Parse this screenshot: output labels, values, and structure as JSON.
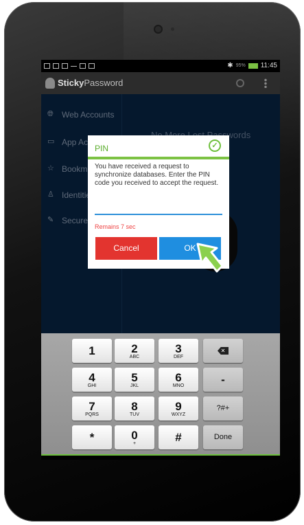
{
  "status_bar": {
    "battery_percent": "95%",
    "time": "11:45",
    "icons": [
      "photo-icon",
      "notification-icon",
      "notification-icon",
      "mail-icon",
      "bag-icon",
      "image-icon"
    ]
  },
  "app_bar": {
    "brand_bold": "Sticky",
    "brand_rest": "Password"
  },
  "sidebar": {
    "items": [
      {
        "label": "Web Accounts",
        "icon": "globe-icon"
      },
      {
        "label": "App Ac",
        "icon": "monitor-icon"
      },
      {
        "label": "Bookm",
        "icon": "star-icon"
      },
      {
        "label": "Identitie",
        "icon": "person-icon"
      },
      {
        "label": "Secure",
        "icon": "note-icon"
      }
    ]
  },
  "main": {
    "headline": "No More Lost Passwords"
  },
  "dialog": {
    "title": "PIN",
    "message": "You have received a request to synchronize databases. Enter the PIN code you received to accept the request.",
    "pin_value": "",
    "remaining": "Remains 7 sec",
    "cancel_label": "Cancel",
    "ok_label": "OK"
  },
  "keyboard": {
    "rows": [
      [
        {
          "n": "1",
          "s": ""
        },
        {
          "n": "2",
          "s": "ABC"
        },
        {
          "n": "3",
          "s": "DEF"
        },
        {
          "n": "⌫",
          "s": "",
          "special": "backspace"
        }
      ],
      [
        {
          "n": "4",
          "s": "GHI"
        },
        {
          "n": "5",
          "s": "JKL"
        },
        {
          "n": "6",
          "s": "MNO"
        },
        {
          "n": "-",
          "s": ""
        }
      ],
      [
        {
          "n": "7",
          "s": "PQRS"
        },
        {
          "n": "8",
          "s": "TUV"
        },
        {
          "n": "9",
          "s": "WXYZ"
        },
        {
          "n": "?#+",
          "s": ""
        }
      ],
      [
        {
          "n": "*",
          "s": ""
        },
        {
          "n": "0",
          "s": "+"
        },
        {
          "n": "#",
          "s": ""
        },
        {
          "n": "Done",
          "s": ""
        }
      ]
    ]
  },
  "colors": {
    "accent_green": "#7cc243",
    "cancel_red": "#e3342f",
    "ok_blue": "#1f8ee0",
    "nav_bg": "#07203c"
  }
}
